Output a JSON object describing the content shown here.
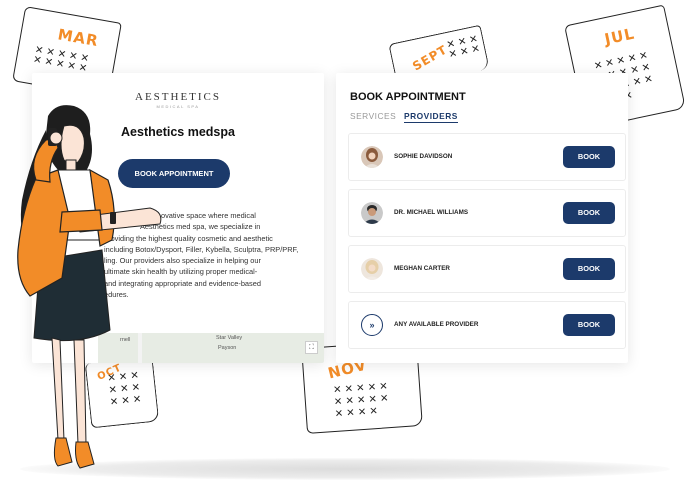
{
  "calendars": [
    {
      "month": "MAR"
    },
    {
      "month": "SEPT"
    },
    {
      "month": "JUL"
    },
    {
      "month": "OCT"
    },
    {
      "month": "NOV"
    }
  ],
  "left_panel": {
    "logo_text": "AESTHETICS",
    "logo_sub": "MEDICAL SPA",
    "business_name": "Aesthetics medspa",
    "book_button": "BOOK APPOINTMENT",
    "description_lines": [
      "An innovative space where medical",
      "Aesthetics med spa, we specialize in",
      "providing the highest quality cosmetic and aesthetic",
      "including Botox/Dysport, Filler, Kybella, Sculptra, PRP/PRF,",
      "ling. Our providers also specialize in helping our",
      "ultimate skin health by utilizing proper medical-",
      "and integrating appropriate and evidence-based",
      "edures."
    ],
    "map_labels": {
      "city1": "Star Valley",
      "city2": "Payson",
      "city3": "rnell"
    }
  },
  "right_panel": {
    "title": "BOOK APPOINTMENT",
    "tabs": {
      "services": "SERVICES",
      "providers": "PROVIDERS"
    },
    "providers": [
      {
        "name": "SOPHIE DAVIDSON",
        "button": "BOOK"
      },
      {
        "name": "DR. MICHAEL WILLIAMS",
        "button": "BOOK"
      },
      {
        "name": "MEGHAN CARTER",
        "button": "BOOK"
      },
      {
        "name": "ANY AVAILABLE PROVIDER",
        "button": "BOOK"
      }
    ],
    "any_icon": "»"
  },
  "colors": {
    "brand_navy": "#1c3a6b",
    "accent_orange": "#f28c28"
  }
}
